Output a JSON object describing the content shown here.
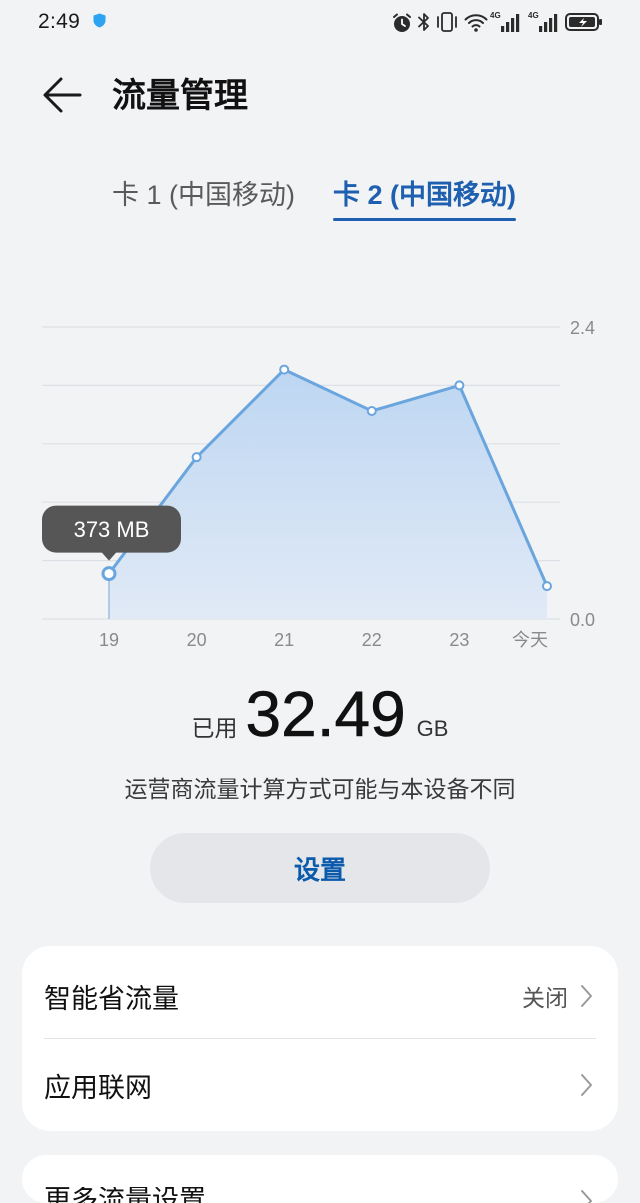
{
  "status_bar": {
    "time": "2:49",
    "network_type_1": "4G",
    "network_type_2": "4G",
    "icons_left": [
      "shield-icon"
    ],
    "icons_right": [
      "alarm-icon",
      "bluetooth-icon",
      "vibrate-icon",
      "wifi-icon",
      "signal-icon",
      "signal-icon",
      "battery-icon"
    ]
  },
  "header": {
    "back_icon": "back-arrow-icon",
    "title": "流量管理"
  },
  "tabs": [
    {
      "label": "卡 1 (中国移动)",
      "active": false
    },
    {
      "label": "卡 2 (中国移动)",
      "active": true
    }
  ],
  "colors": {
    "background": "#f1f3f5",
    "accent": "#1e5fb0",
    "chart_line": "#6aa5de",
    "tooltip": "#565656",
    "button_background": "#e4e6e9",
    "button_text": "#0b5aab"
  },
  "chart_data": {
    "type": "area",
    "categories": [
      "19",
      "20",
      "21",
      "22",
      "23",
      "今天"
    ],
    "values": [
      0.373,
      1.33,
      2.05,
      1.71,
      1.92,
      0.27
    ],
    "ylim": [
      0,
      2.4
    ],
    "y_ticks": [
      {
        "value": 2.4,
        "label": "2.4"
      },
      {
        "value": 0,
        "label": "0.0"
      }
    ],
    "y_axis_side": "right",
    "y_grid_step": 0.48,
    "grid": true,
    "highlight": {
      "category": "19",
      "label": "373 MB"
    }
  },
  "usage": {
    "prefix": "已用",
    "value": "32.49",
    "unit": "GB",
    "note": "运营商流量计算方式可能与本设备不同"
  },
  "settings_button": {
    "label": "设置"
  },
  "list_card_1": {
    "items": [
      {
        "label": "智能省流量",
        "value": "关闭"
      },
      {
        "label": "应用联网"
      }
    ]
  },
  "list_card_2": {
    "items": [
      {
        "label": "更多流量设置"
      }
    ]
  }
}
